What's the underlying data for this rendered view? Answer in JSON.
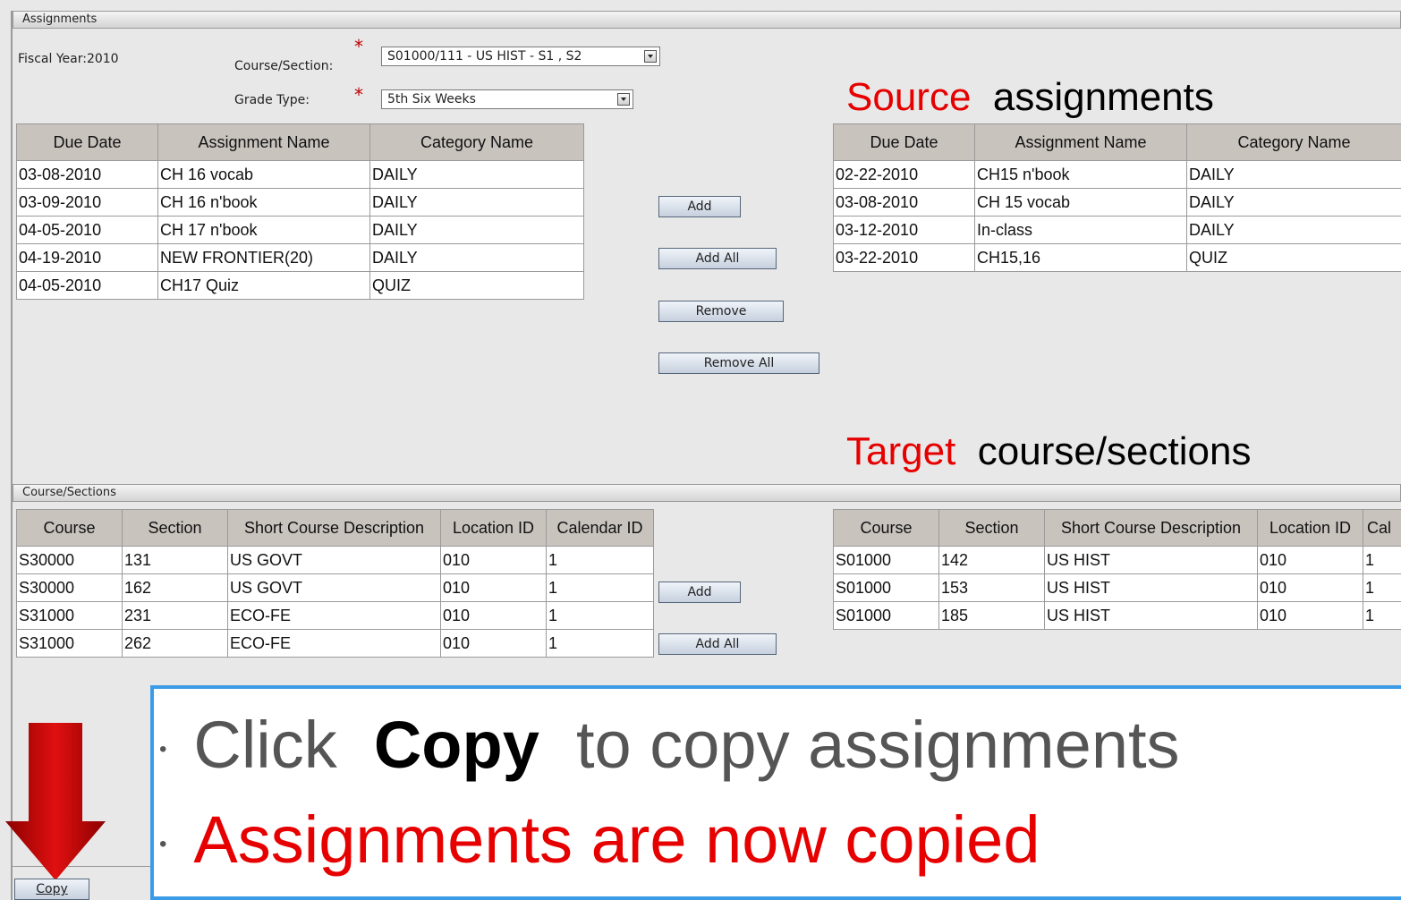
{
  "assignments_panel": {
    "title": "Assignments",
    "fiscal_year_label": "Fiscal Year:",
    "fiscal_year_value": "2010",
    "course_section_label": "Course/Section:",
    "course_section_value": "S01000/111 - US HIST - S1 , S2",
    "grade_type_label": "Grade Type:",
    "grade_type_value": "5th Six Weeks",
    "required_mark": "*"
  },
  "left_assignments": {
    "headers": [
      "Due Date",
      "Assignment Name",
      "Category Name"
    ],
    "rows": [
      [
        "03-08-2010",
        "CH 16 vocab",
        "DAILY"
      ],
      [
        "03-09-2010",
        "CH 16 n'book",
        "DAILY"
      ],
      [
        "04-05-2010",
        "CH 17 n'book",
        "DAILY"
      ],
      [
        "04-19-2010",
        "NEW FRONTIER(20)",
        "DAILY"
      ],
      [
        "04-05-2010",
        "CH17 Quiz",
        "QUIZ"
      ]
    ]
  },
  "right_assignments": {
    "headers": [
      "Due Date",
      "Assignment Name",
      "Category Name"
    ],
    "rows": [
      [
        "02-22-2010",
        "CH15 n'book",
        "DAILY"
      ],
      [
        "03-08-2010",
        "CH 15 vocab",
        "DAILY"
      ],
      [
        "03-12-2010",
        "In-class",
        "DAILY"
      ],
      [
        "03-22-2010",
        "CH15,16",
        "QUIZ"
      ]
    ]
  },
  "assignment_buttons": {
    "add": "Add",
    "add_all": "Add All",
    "remove": "Remove",
    "remove_all": "Remove All"
  },
  "annotations": {
    "source_word": "Source",
    "source_rest": "assignments",
    "target_word": "Target",
    "target_rest": "course/sections",
    "accent_color": "#e60000"
  },
  "course_sections_panel": {
    "title": "Course/Sections"
  },
  "left_courses": {
    "headers": [
      "Course",
      "Section",
      "Short Course Description",
      "Location ID",
      "Calendar ID"
    ],
    "rows": [
      [
        "S30000",
        "131",
        "US GOVT",
        "010",
        "1"
      ],
      [
        "S30000",
        "162",
        "US GOVT",
        "010",
        "1"
      ],
      [
        "S31000",
        "231",
        "ECO-FE",
        "010",
        "1"
      ],
      [
        "S31000",
        "262",
        "ECO-FE",
        "010",
        "1"
      ]
    ]
  },
  "right_courses": {
    "headers": [
      "Course",
      "Section",
      "Short Course Description",
      "Location ID",
      "Cal"
    ],
    "rows": [
      [
        "S01000",
        "142",
        "US HIST",
        "010",
        "1"
      ],
      [
        "S01000",
        "153",
        "US HIST",
        "010",
        "1"
      ],
      [
        "S01000",
        "185",
        "US HIST",
        "010",
        "1"
      ]
    ]
  },
  "course_buttons": {
    "add": "Add",
    "add_all": "Add All"
  },
  "callout": {
    "line1_pre": "Click",
    "line1_bold": "Copy",
    "line1_post": "to copy assignments",
    "line2": "Assignments are now copied",
    "border_color": "#3b9be6"
  },
  "footer": {
    "copy_button": "Copy"
  }
}
